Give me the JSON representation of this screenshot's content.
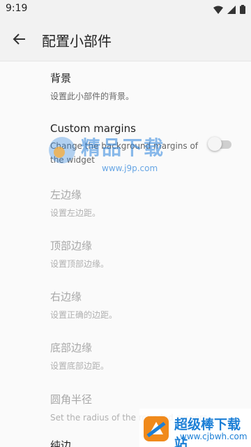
{
  "status_bar": {
    "time": "9:19"
  },
  "app_bar": {
    "title": "配置小部件"
  },
  "prefs": [
    {
      "title": "背景",
      "summary": "设置此小部件的背景。"
    },
    {
      "title": "Custom margins",
      "summary": "Change the background margins of the widget"
    },
    {
      "title": "左边缘",
      "summary": "设置左边距。"
    },
    {
      "title": "顶部边缘",
      "summary": "设置顶部边缘。"
    },
    {
      "title": "右边缘",
      "summary": "设置正确的边距。"
    },
    {
      "title": "底部边缘",
      "summary": "设置底部边距。"
    },
    {
      "title": "圆角半径",
      "summary": "Set the radius of the rounded corners."
    },
    {
      "title": "纯边"
    }
  ],
  "custom_margins_toggle": {
    "checked": false
  },
  "watermark_top": {
    "text": "精品下载",
    "url": "www.j9p.com"
  },
  "watermark_bottom": {
    "text": "超级棒下载站",
    "url": "www.cjbwh.com"
  },
  "colors": {
    "accent": "#1c7fd6",
    "disabled_text": "#a8a8a8"
  }
}
